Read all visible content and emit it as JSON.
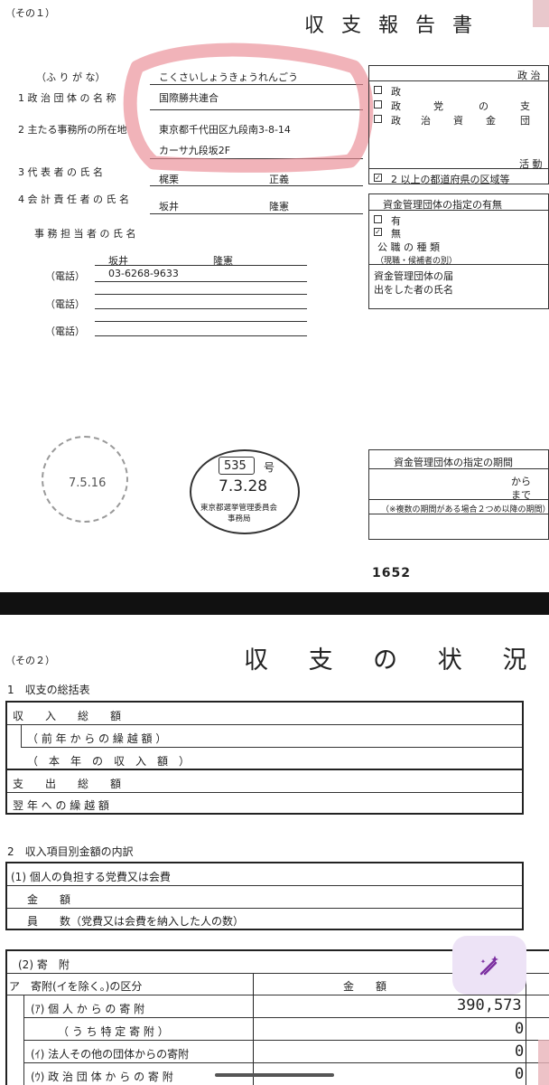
{
  "page1": {
    "form_no": "（その１）",
    "title": "収 支 報 告 書",
    "labels": {
      "furigana": "（ふ り が な）",
      "org_name": "1 政 治 団 体 の 名 称",
      "office_address": "2 主たる事務所の所在地",
      "representative": "3 代 表 者 の 氏 名",
      "treasurer": "4 会 計 責 任 者 の 氏 名",
      "staff": "事 務 担 当 者 の 氏 名",
      "phone": "（電話）"
    },
    "values": {
      "furigana": "こくさいしょうきょうれんごう",
      "org_name": "国際勝共連合",
      "address_line1": "東京都千代田区九段南3-8-14",
      "address_line2": "カーサ九段坂2F",
      "rep_surname": "梶栗",
      "rep_given": "正義",
      "treasurer_surname": "坂井",
      "treasurer_given": "隆憲",
      "staff_surname": "坂井",
      "staff_given": "隆憲",
      "phone1": "03-6268-9633"
    },
    "right_panel": {
      "heading_political": "政 治",
      "type_party": "政",
      "type_branch_1": "政",
      "type_branch_2": "党",
      "type_branch_3": "の",
      "type_branch_4": "支",
      "type_fund_1": "政",
      "type_fund_2": "治",
      "type_fund_3": "資",
      "type_fund_4": "金",
      "type_fund_5": "団",
      "heading_activity": "活 動",
      "activity_area": "2 以上の都道府県の区域等",
      "check_mark": "✓",
      "fund_designation_heading": "資金管理団体の指定の有無",
      "option_yes": "有",
      "option_no": "無",
      "office_type": "公 職 の 種 類",
      "office_type_note": "（現職・候補者の別）",
      "notifier_line1": "資金管理団体の届",
      "notifier_line2": "出をした者の氏名",
      "period_heading": "資金管理団体の指定の期間",
      "period_from": "から",
      "period_to": "まで",
      "period_note": "（※複数の期間がある場合２つめ以降の期間）"
    },
    "stamps": {
      "received_date": "7.5.16",
      "receipt_no": "535",
      "receipt_no_suffix": "号",
      "receipt_date": "7.3.28",
      "receipt_org_line1": "東京都選挙管理委員会",
      "receipt_org_line2": "事務局"
    },
    "page_number": "1652"
  },
  "page2": {
    "form_no": "（その２）",
    "title": "収 支 の 状 況",
    "section1_title": "1　収支の総括表",
    "summary_rows": [
      {
        "label": "収　　入　　総　　額"
      },
      {
        "label": "（ 前 年 か ら の 繰 越 額 ）"
      },
      {
        "label": "（　本　年　の　収　入　額　）"
      },
      {
        "label": "支　　出　　総　　額"
      },
      {
        "label": "翌 年 へ の 繰 越 額"
      }
    ],
    "section2_title": "2　収入項目別金額の内訳",
    "fees_title": "(1) 個人の負担する党費又は会費",
    "fees_rows": [
      {
        "label": "金　　額"
      },
      {
        "label": "員　　数（党費又は会費を納入した人の数）"
      }
    ],
    "donation_title": "(2) 寄　附",
    "donation_header_label": "ア　寄附(イを除く。)の区分",
    "donation_header_amount": "金　　額",
    "donation_rows": [
      {
        "label": "(ｱ) 個 人 か ら の 寄 附",
        "amount": "390,573"
      },
      {
        "label": "（ う ち 特 定 寄 附 ）",
        "amount": "0"
      },
      {
        "label": "(ｲ) 法人その他の団体からの寄附",
        "amount": "0"
      },
      {
        "label": "(ｳ) 政 治 団 体 か ら の 寄 附",
        "amount": "0"
      }
    ]
  },
  "ui": {
    "fab_icon": "pen-sparkle-icon",
    "accent": "#7b2fa0",
    "fab_bg": "#ede3f6",
    "highlight": "#e98a94"
  }
}
